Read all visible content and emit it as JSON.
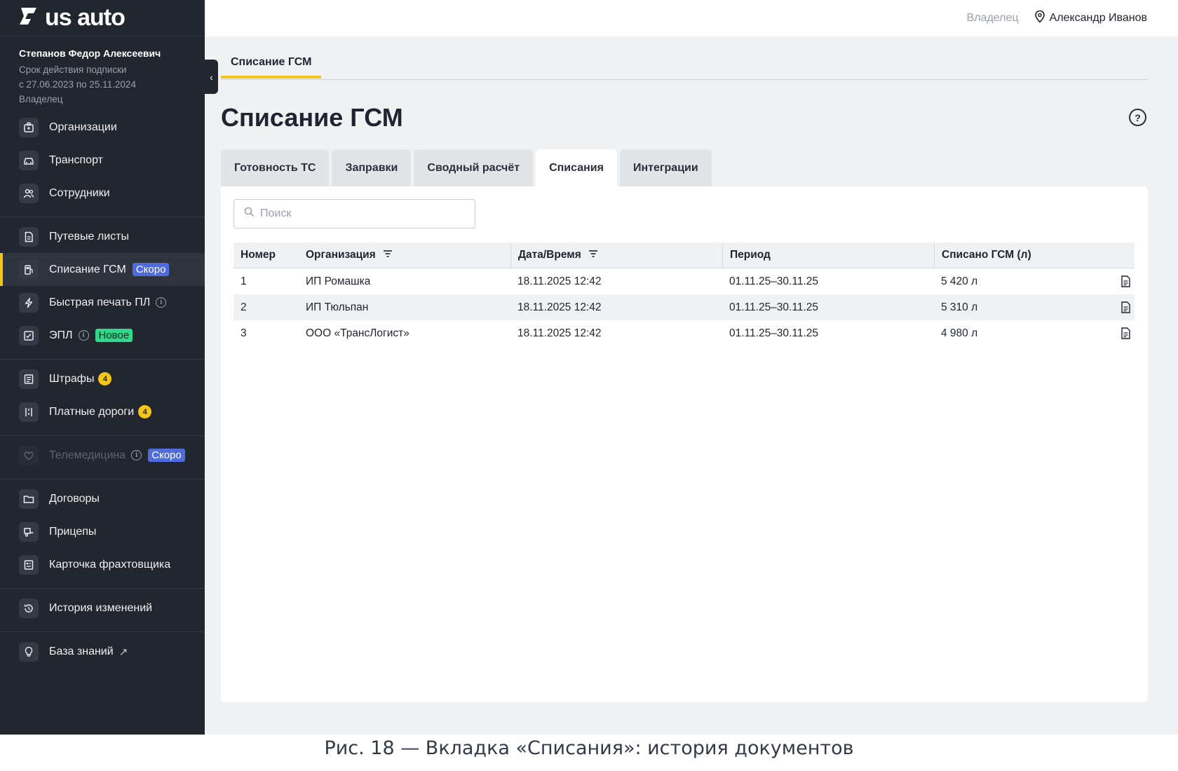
{
  "brand": {
    "logo_text": "us auto",
    "accent": "#f5c518"
  },
  "profile": {
    "name": "Степанов Федор Алексеевич",
    "subscription_label": "Срок действия подписки",
    "subscription_period": "с 27.06.2023 по 25.11.2024",
    "role": "Владелец"
  },
  "sidebar": {
    "items": [
      {
        "label": "Организации",
        "icon": "building-icon"
      },
      {
        "label": "Транспорт",
        "icon": "car-icon"
      },
      {
        "label": "Сотрудники",
        "icon": "people-icon"
      },
      {
        "label": "Путевые листы",
        "icon": "document-icon"
      },
      {
        "label": "Списание ГСМ",
        "icon": "fuel-icon",
        "badge": "Скоро",
        "active": true
      },
      {
        "label": "Быстрая печать ПЛ",
        "icon": "lightning-icon"
      },
      {
        "label": "ЭПЛ",
        "icon": "epl-icon",
        "badge": "Новое"
      },
      {
        "label": "Штрафы",
        "icon": "list-icon",
        "count": "4"
      },
      {
        "label": "Платные дороги",
        "icon": "road-icon",
        "count": "4"
      },
      {
        "label": "Телемедицина",
        "icon": "heart-icon",
        "badge": "Скоро",
        "disabled": true
      },
      {
        "label": "Договоры",
        "icon": "folder-icon"
      },
      {
        "label": "Прицепы",
        "icon": "trailer-icon"
      },
      {
        "label": "Карточка фрахтовщика",
        "icon": "card-icon"
      },
      {
        "label": "История изменений",
        "icon": "history-icon"
      },
      {
        "label": "База знаний",
        "icon": "bulb-icon"
      }
    ]
  },
  "topbar": {
    "role": "Владелец",
    "user": "Александр Иванов"
  },
  "breadcrumb": "Списание ГСМ",
  "page_title": "Списание ГСМ",
  "tabs": [
    "Готовность ТС",
    "Заправки",
    "Сводный расчёт",
    "Списания",
    "Интеграции"
  ],
  "search": {
    "placeholder": "Поиск",
    "value": ""
  },
  "table": {
    "columns": [
      "Номер",
      "Организация",
      "Дата/Время",
      "Период",
      "Списано ГСМ (л)"
    ],
    "rows": [
      [
        "1",
        "ИП Ромашка",
        "18.11.2025 12:42",
        "01.11.25–30.11.25",
        "5 420 л"
      ],
      [
        "2",
        "ИП Тюльпан",
        "18.11.2025 12:42",
        "01.11.25–30.11.25",
        "5 310 л"
      ],
      [
        "3",
        "ООО «ТрансЛогист»",
        "18.11.2025 12:42",
        "01.11.25–30.11.25",
        "4 980 л"
      ]
    ]
  },
  "caption": "Рис. 18 — Вкладка «Списания»: история документов"
}
